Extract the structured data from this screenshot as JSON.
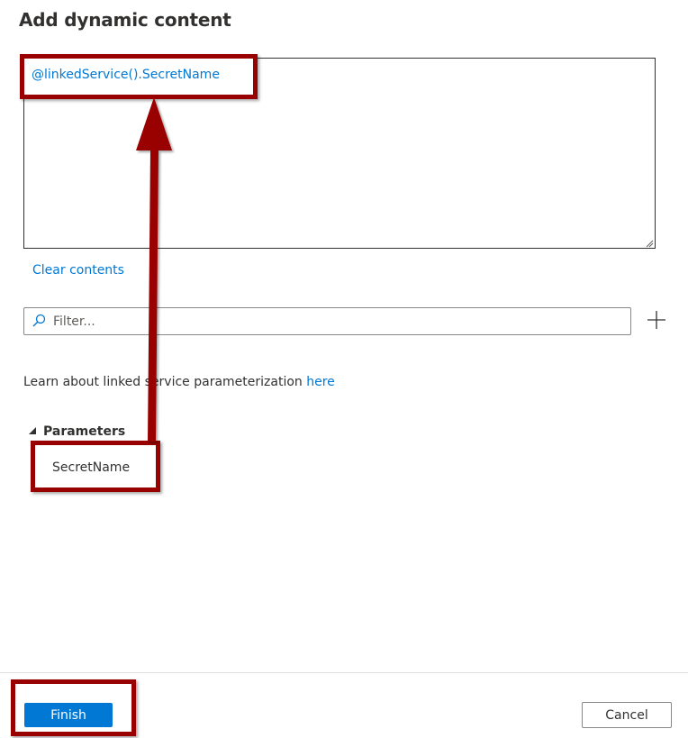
{
  "dialog": {
    "title": "Add dynamic content"
  },
  "expression": {
    "value": "@linkedService().SecretName"
  },
  "actions": {
    "clear_contents": "Clear contents",
    "add_icon": "plus-icon"
  },
  "filter": {
    "placeholder": "Filter...",
    "value": "",
    "icon": "search-icon"
  },
  "learn": {
    "text": "Learn about linked service parameterization ",
    "link": "here"
  },
  "parameters": {
    "header": "Parameters",
    "expanded": true,
    "items": [
      {
        "label": "SecretName"
      }
    ]
  },
  "footer": {
    "finish_label": "Finish",
    "cancel_label": "Cancel"
  },
  "annotations": {
    "color": "#990000",
    "arrow": "from-parameter-to-expression"
  },
  "colors": {
    "accent": "#0078d4",
    "text": "#323130",
    "annotation": "#990000"
  }
}
